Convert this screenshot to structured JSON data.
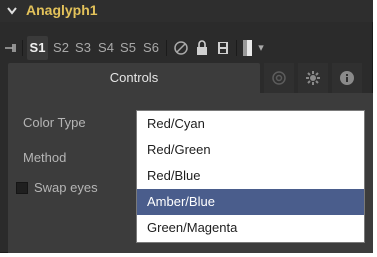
{
  "tool": {
    "name": "Anaglyph1"
  },
  "toolbar": {
    "version_slots": [
      "S1",
      "S2",
      "S3",
      "S4",
      "S5",
      "S6"
    ],
    "active_slot": "S1",
    "chevron": "▾"
  },
  "tabs": {
    "controls_label": "Controls"
  },
  "controls": {
    "color_type_label": "Color Type",
    "method_label": "Method",
    "swap_eyes_label": "Swap eyes",
    "swap_eyes_checked": false
  },
  "dropdown": {
    "options": [
      "Red/Cyan",
      "Red/Green",
      "Red/Blue",
      "Amber/Blue",
      "Green/Magenta"
    ],
    "highlighted_index": 3
  },
  "colors": {
    "tool_name": "#e3c25a",
    "highlight": "#4a5d8c",
    "panel_bg": "#2b2b2b",
    "control_bg": "#3c3c3c"
  },
  "icons": [
    "collapse-caret-icon",
    "pin-icon",
    "disable-icon",
    "lock-icon",
    "save-icon",
    "color-swatch-icon",
    "dropdown-chevron-icon",
    "modifier-icon",
    "settings-icon",
    "info-icon"
  ]
}
